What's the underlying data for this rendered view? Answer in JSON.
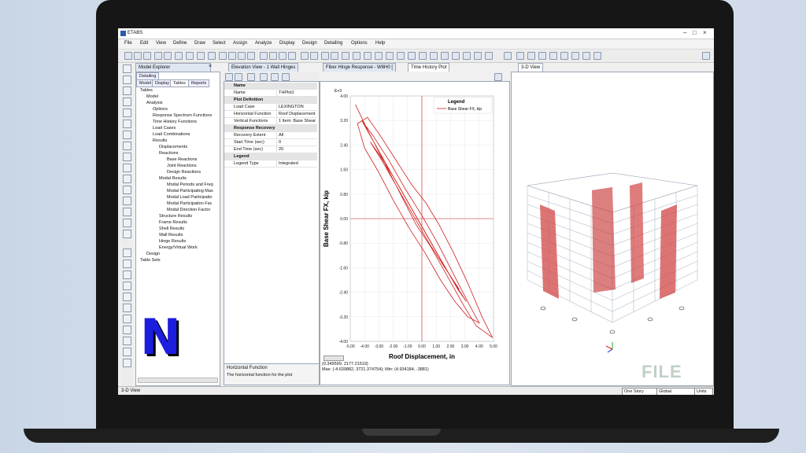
{
  "app": {
    "title": "ETABS"
  },
  "menu": [
    "File",
    "Edit",
    "View",
    "Define",
    "Draw",
    "Select",
    "Assign",
    "Analyze",
    "Display",
    "Design",
    "Detailing",
    "Options",
    "Help"
  ],
  "explorer": {
    "title": "Model Explorer",
    "detailing_tab": "Detailing",
    "tabs": [
      "Model",
      "Display",
      "Tables",
      "Reports"
    ],
    "tree": [
      "Tables",
      "Model",
      "Analysis",
      "Options",
      "Response Spectrum Functions",
      "Time History Functions",
      "Load Cases",
      "Load Combinations",
      "Results",
      "Displacements",
      "Reactions",
      "Base Reactions",
      "Joint Reactions",
      "Design Reactions",
      "Modal Results",
      "Modal Periods and Freq",
      "Modal Participating Mas",
      "Modal Load Participatio",
      "Modal Participation Fac",
      "Modal Direction Factor",
      "Structure Results",
      "Frame Results",
      "Shell Results",
      "Wall Results",
      "Hinge Results",
      "Energy/Virtual Work",
      "Design",
      "Table Sets"
    ]
  },
  "doc_tabs": [
    "Elevation View - 1  Wall Hinges",
    "Fiber Hinge Response - W6H0 [",
    "Time History Plot"
  ],
  "view3d_tab": "3-D View",
  "props": {
    "rows": [
      {
        "cat": true,
        "k": "Name",
        "v": ""
      },
      {
        "cat": false,
        "k": "Name",
        "v": "THPlot1"
      },
      {
        "cat": true,
        "k": "Plot Definition",
        "v": ""
      },
      {
        "cat": false,
        "k": "Load Case",
        "v": "LEXINGTON"
      },
      {
        "cat": false,
        "k": "Horizontal Function",
        "v": "Roof Displacement"
      },
      {
        "cat": false,
        "k": "Vertical Functions",
        "v": "1 Item: Base Shear F"
      },
      {
        "cat": true,
        "k": "Response Recovery",
        "v": ""
      },
      {
        "cat": false,
        "k": "Recovery Extent",
        "v": "All"
      },
      {
        "cat": false,
        "k": "Start Time (sec)",
        "v": "0"
      },
      {
        "cat": false,
        "k": "End Time (sec)",
        "v": "20"
      },
      {
        "cat": true,
        "k": "Legend",
        "v": ""
      },
      {
        "cat": false,
        "k": "Legend Type",
        "v": "Integrated"
      }
    ],
    "help_title": "Horizontal Function",
    "help_text": "The horizontal function for the plot"
  },
  "plot_footer": {
    "line1": "(0.349599, 2177.21519)",
    "line2": "Max: (-4.639882, 3721.374754);    Min: (4.934184, -3881)"
  },
  "chart_data": {
    "type": "line",
    "title": "",
    "xlabel": "Roof Displacement,  in",
    "ylabel": "Base Shear FX,  kip",
    "y_multiplier": "E+3",
    "xlim": [
      -5.0,
      5.0
    ],
    "ylim": [
      -4.0,
      4.0
    ],
    "xticks": [
      "-5.00",
      "-4.00",
      "-3.00",
      "-2.00",
      "-1.00",
      "0.00",
      "1.00",
      "2.00",
      "3.00",
      "4.00",
      "5.00"
    ],
    "yticks": [
      "4.00",
      "3.20",
      "2.40",
      "1.60",
      "0.80",
      "0.00",
      "-0.80",
      "-1.60",
      "-2.40",
      "-3.20",
      "-4.00"
    ],
    "legend": {
      "title": "Legend",
      "position": "top-right"
    },
    "grid": true,
    "color": "#d11f1f",
    "series": [
      {
        "name": "Base Shear FX, kip",
        "x": [
          -4.64,
          -3.8,
          -2.7,
          -1.6,
          -0.4,
          0.6,
          1.8,
          3.0,
          3.8,
          4.4,
          4.93,
          4.2,
          3.2,
          2.2,
          1.2,
          0.3,
          -0.7,
          -1.8,
          -2.9,
          -3.8,
          -4.5,
          -4.0,
          -3.0,
          -2.0,
          -0.9,
          0.2,
          1.3,
          2.3,
          3.2,
          4.0,
          3.3,
          2.2,
          1.1,
          0.0,
          -1.2,
          -2.3,
          -3.4,
          -4.2,
          -3.6,
          -2.4,
          -1.3,
          -0.2,
          0.9,
          2.0,
          3.1,
          2.5,
          1.4,
          0.3,
          -0.8,
          -1.9,
          -3.0,
          -3.6,
          -2.8,
          -1.7,
          -0.6,
          0.5,
          1.6,
          2.6
        ],
        "y": [
          3.72,
          2.9,
          1.9,
          0.9,
          -0.2,
          -0.9,
          -1.9,
          -2.9,
          -3.5,
          -3.7,
          -3.88,
          -3.2,
          -2.1,
          -1.1,
          -0.2,
          0.5,
          1.1,
          1.9,
          2.7,
          3.3,
          3.1,
          2.3,
          1.5,
          0.6,
          -0.3,
          -1.1,
          -2.0,
          -2.7,
          -3.2,
          -3.4,
          -2.8,
          -1.8,
          -0.8,
          0.1,
          1.0,
          1.9,
          2.7,
          3.2,
          2.7,
          1.7,
          0.8,
          -0.1,
          -1.0,
          -1.9,
          -2.7,
          -2.3,
          -1.4,
          -0.5,
          0.4,
          1.3,
          2.1,
          2.5,
          1.9,
          1.0,
          0.1,
          -0.8,
          -1.6,
          -2.3
        ]
      }
    ]
  },
  "status": {
    "left": "3-D View",
    "story": "One Story",
    "coord": "Global",
    "units": "Units"
  }
}
